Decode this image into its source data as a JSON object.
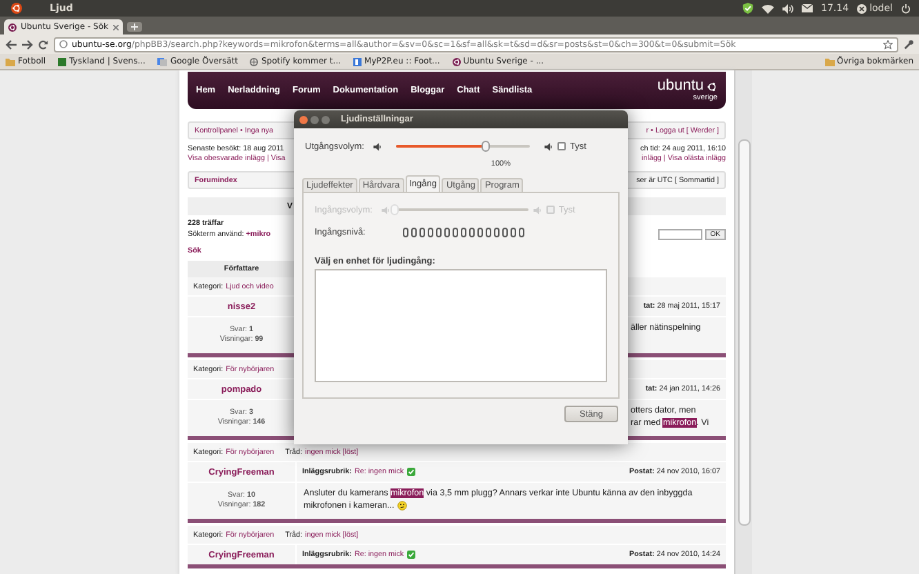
{
  "top_panel": {
    "app_title": "Ljud",
    "clock": "17.14",
    "user": "lodel"
  },
  "browser": {
    "tab_title": "Ubuntu Sverige - Sök",
    "url_host": "ubuntu-se.org",
    "url_path": "/phpBB3/search.php?keywords=mikrofon&terms=all&author=&sv=0&sc=1&sf=all&sk=t&sd=d&sr=posts&st=0&ch=300&t=0&submit=Sök",
    "bookmarks": [
      {
        "kind": "folder",
        "label": "Fotboll"
      },
      {
        "kind": "square",
        "label": "Tyskland | Svens..."
      },
      {
        "kind": "translate",
        "label": "Google Översätt"
      },
      {
        "kind": "globe",
        "label": "Spotify kommer t..."
      },
      {
        "kind": "page",
        "label": "MyP2P.eu :: Foot..."
      },
      {
        "kind": "ubuntu",
        "label": "Ubuntu Sverige - ..."
      }
    ],
    "other_bookmarks": "Övriga bokmärken"
  },
  "site": {
    "nav": [
      "Hem",
      "Nerladdning",
      "Forum",
      "Dokumentation",
      "Bloggar",
      "Chatt",
      "Sändlista"
    ],
    "logo_word": "ubuntu",
    "logo_sub": "sverige",
    "breadcrumb_left": "Kontrollpanel • Inga nya",
    "breadcrumb_right": "r • Logga ut [ Werder ]",
    "last_visit": "Senaste besökt: 18 aug 2011",
    "links_left": "Visa obesvarade inlägg | Visa",
    "time_right": "ch tid: 24 aug 2011, 16:10",
    "links_right": "inlägg | Visa olästa inlägg",
    "forum_index": "Forumindex",
    "timezone": "ser är UTC [ Sommartid ]",
    "bar_fragment": "V",
    "hits": "228 träffar",
    "search_term_label": "Sökterm använd:",
    "search_term": "+mikro",
    "ok_button": "OK",
    "search_link": "Sök",
    "author_header": "Författare",
    "results": [
      {
        "kind": "covered",
        "category_label": "Kategori:",
        "category": "Ljud och video",
        "author": "nisse2",
        "posted": "**tat:** 28 maj 2011, 15:17",
        "replies": "Svar: **1**",
        "views": "Visningar: **99**",
        "excerpt_lines": [
          [
            {
              "text": "äller nätinspelning",
              "highlight": false
            }
          ]
        ],
        "emoticon": false
      },
      {
        "kind": "covered",
        "category_label": "Kategori:",
        "category": "För nybörjaren",
        "author": "pompado",
        "posted": "**tat:** 24 jan 2011, 14:26",
        "replies": "Svar: **3**",
        "views": "Visningar: **146**",
        "excerpt_lines": [
          [
            {
              "text": "otters dator, men",
              "highlight": false
            }
          ],
          [
            {
              "text": "rar med ",
              "highlight": false
            },
            {
              "text": "mikrofon",
              "highlight": true
            },
            {
              "text": ". Vi",
              "highlight": false
            }
          ]
        ],
        "emoticon": false
      },
      {
        "kind": "full",
        "category_label": "Kategori:",
        "category": "För nybörjaren",
        "thread_label": "Tråd:",
        "thread": "ingen mick [löst]",
        "author": "CryingFreeman",
        "subject_label": "Inläggsrubrik:",
        "subject": "Re: ingen mick",
        "solved": true,
        "posted": "**Postat:** 24 nov 2010, 16:07",
        "replies": "Svar: **10**",
        "views": "Visningar: **182**",
        "excerpt_lines": [
          [
            {
              "text": "Ansluter du kamerans ",
              "highlight": false
            },
            {
              "text": "mikrofon",
              "highlight": true
            },
            {
              "text": " via 3,5 mm plugg? Annars verkar inte Ubuntu känna av den inbyggda",
              "highlight": false
            }
          ],
          [
            {
              "text": "mikrofonen i kameran...",
              "highlight": false
            }
          ]
        ],
        "emoticon": true
      },
      {
        "kind": "full",
        "category_label": "Kategori:",
        "category": "För nybörjaren",
        "thread_label": "Tråd:",
        "thread": "ingen mick [löst]",
        "author": "CryingFreeman",
        "subject_label": "Inläggsrubrik:",
        "subject": "Re: ingen mick",
        "solved": true,
        "posted": "**Postat:** 24 nov 2010, 14:24",
        "emoticon": false
      }
    ]
  },
  "dialog": {
    "title": "Ljudinställningar",
    "output_volume": {
      "label": "Utgångsvolym:",
      "level": 0.67,
      "mark": "100%",
      "muted": false,
      "mute_label": "Tyst"
    },
    "tabs": [
      {
        "label": "Ljudeffekter",
        "selected": false
      },
      {
        "label": "Hårdvara",
        "selected": false
      },
      {
        "label": "Ingång",
        "selected": true
      },
      {
        "label": "Utgång",
        "selected": false
      },
      {
        "label": "Program",
        "selected": false
      }
    ],
    "input_volume": {
      "label": "Ingångsvolym:",
      "level": 0,
      "muted": false,
      "mute_label": "Tyst",
      "disabled": true
    },
    "input_level": {
      "label": "Ingångsnivå:"
    },
    "device_list_label": "Välj en enhet för ljudingång:",
    "close_button": "Stäng"
  }
}
